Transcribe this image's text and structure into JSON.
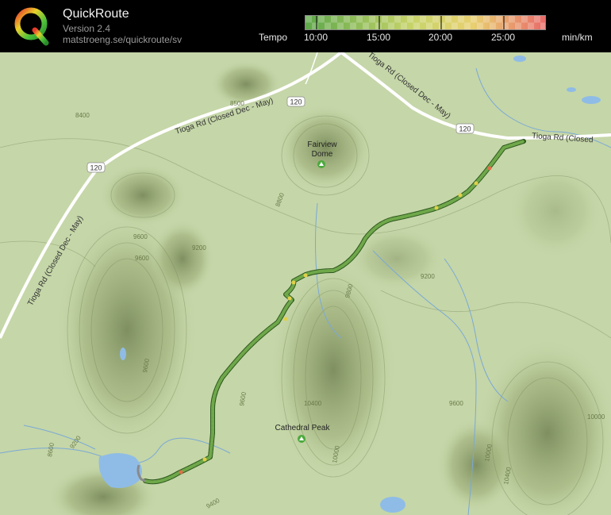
{
  "header": {
    "app_title": "QuickRoute",
    "version": "Version 2.4",
    "url": "matstroeng.se/quickroute/sv"
  },
  "legend": {
    "title": "Tempo",
    "unit": "min/km",
    "ticks": [
      "10:00",
      "15:00",
      "20:00",
      "25:00"
    ],
    "colors": {
      "fast": "#3b9a3b",
      "medium": "#d8d84a",
      "slow": "#e8706a"
    }
  },
  "map": {
    "roads": [
      "Tioga Rd (Closed Dec - May)",
      "Tioga Rd (Closed Dec - May)",
      "Tioga Rd (Closed Dec - May)",
      "Tioga Rd (Closed"
    ],
    "route_shields": [
      "120",
      "120",
      "120"
    ],
    "peaks": [
      {
        "name_line1": "Fairview",
        "name_line2": "Dome"
      },
      {
        "name_line1": "Cathedral Peak",
        "name_line2": ""
      }
    ],
    "contour_labels": [
      "8400",
      "8500",
      "8800",
      "9200",
      "9600",
      "9600",
      "9600",
      "9200",
      "9800",
      "9200",
      "8600",
      "10400",
      "10000",
      "9600",
      "10000",
      "10400",
      "10000",
      "9600",
      "9400"
    ],
    "colors": {
      "terrain": "#c5d6a8",
      "road": "#ffffff",
      "water": "#8fbce6",
      "route_base": "#4b8d2f"
    }
  }
}
